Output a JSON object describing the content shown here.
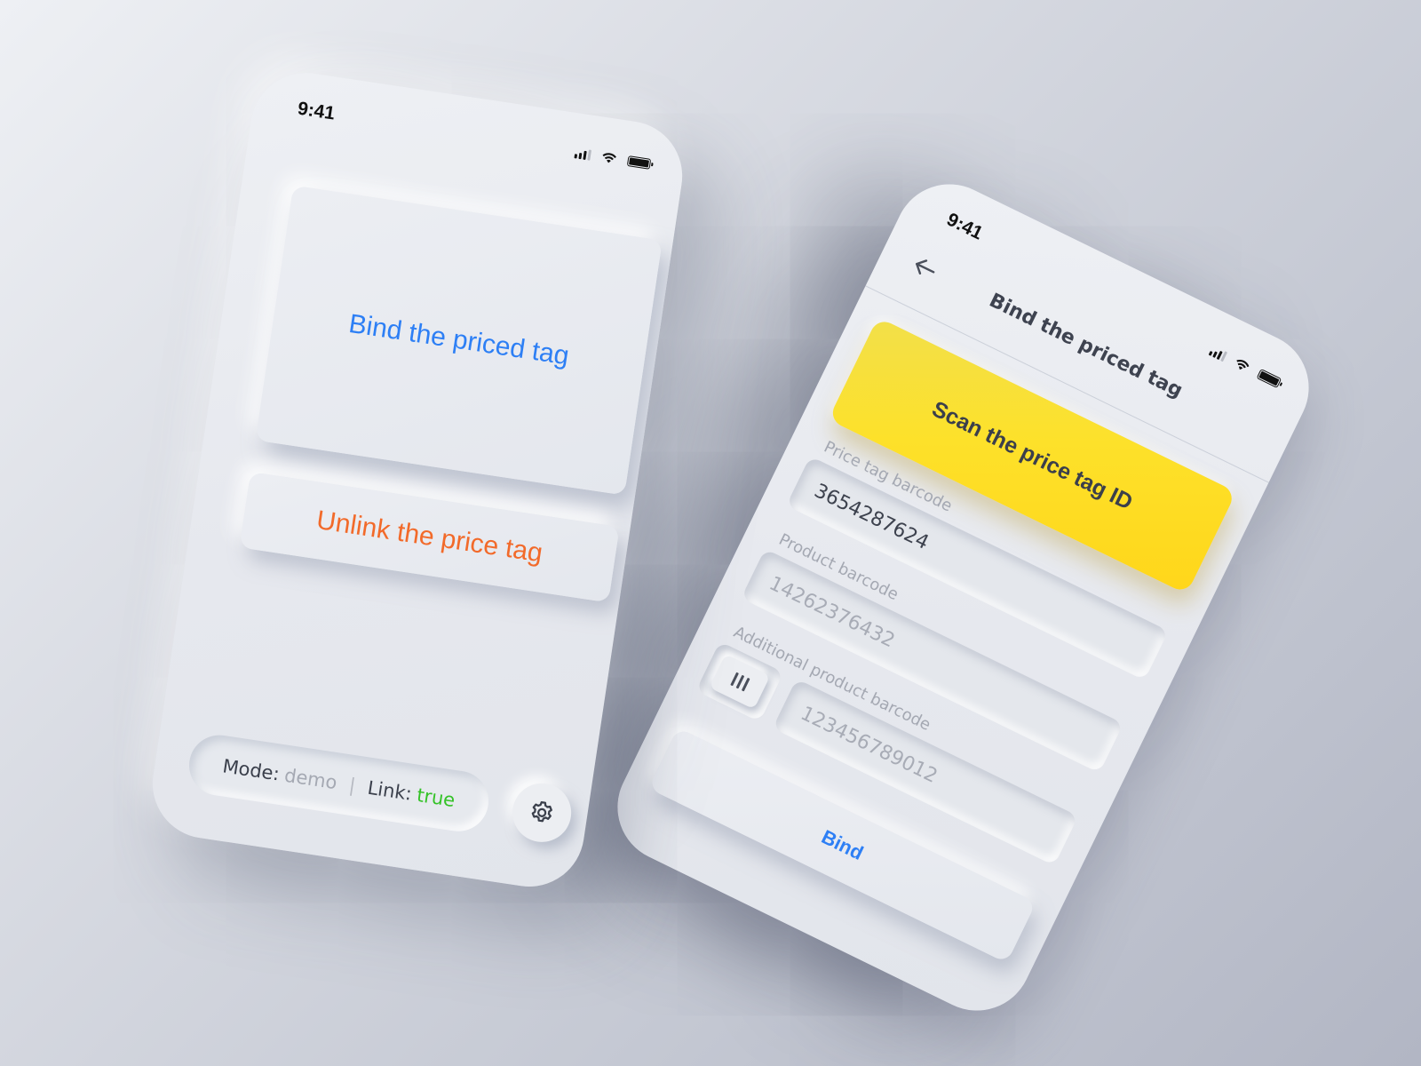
{
  "left_screen": {
    "status": {
      "time": "9:41"
    },
    "bind_card": {
      "label": "Bind the priced tag"
    },
    "unlink_button": {
      "label": "Unlink the price tag"
    },
    "footer": {
      "mode_label": "Mode:",
      "mode_value": "demo",
      "separator": "|",
      "link_label": "Link:",
      "link_value": "true"
    },
    "icons": {
      "settings": "gear-icon",
      "signal": "signal-icon",
      "wifi": "wifi-icon",
      "battery": "battery-icon"
    }
  },
  "right_screen": {
    "status": {
      "time": "9:41"
    },
    "header": {
      "title": "Bind the priced tag",
      "back_icon": "back-arrow-icon"
    },
    "scan_button": {
      "label": "Scan the price tag ID"
    },
    "fields": {
      "price_tag_barcode": {
        "label": "Price tag barcode",
        "value": "3654287624"
      },
      "product_barcode": {
        "label": "Product barcode",
        "placeholder": "14262376432"
      },
      "additional_product_barcode": {
        "label": "Additional product barcode",
        "placeholder": "123456789012"
      }
    },
    "submit": {
      "label": "Bind"
    }
  },
  "colors": {
    "accent_blue": "#2d7ff5",
    "accent_orange": "#f26a2a",
    "accent_green": "#34c227",
    "accent_yellow": "#fde12a"
  }
}
